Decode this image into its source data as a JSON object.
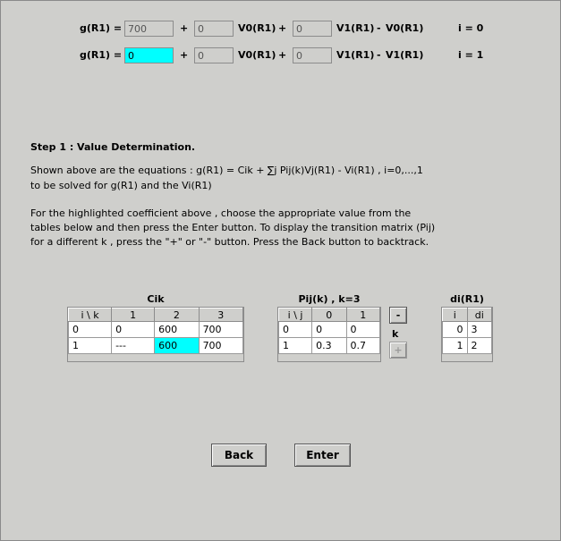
{
  "equations": [
    {
      "g_label": "g(R1) =",
      "g_value": "700",
      "plus1": "+",
      "coef_value": "0",
      "v_a_label": "V0(R1)",
      "plus2": "+",
      "coef2_value": "0",
      "v_b_label": "V1(R1)",
      "minus": "-",
      "v_c_label": "V0(R1)",
      "index": "i = 0"
    },
    {
      "g_label": "g(R1) =",
      "g_value": "0",
      "plus1": "+",
      "coef_value": "0",
      "v_a_label": "V0(R1)",
      "plus2": "+",
      "coef2_value": "0",
      "v_b_label": "V1(R1)",
      "minus": "-",
      "v_c_label": "V1(R1)",
      "index": "i = 1"
    }
  ],
  "step": {
    "title": "Step 1 :  Value Determination.",
    "line1": "Shown above are the equations : g(R1) = Cik + ∑j Pij(k)Vj(R1) - Vi(R1) , i=0,...,1",
    "line2": "to be solved for g(R1) and the Vi(R1)",
    "line3": "For the highlighted coefficient above , choose the appropriate value from the",
    "line4": "tables below and then press the Enter button. To display the transition matrix (Pij)",
    "line5": "for a different k , press the \"+\" or \"-\" button. Press the Back button to backtrack."
  },
  "cik": {
    "title": "Cik",
    "headers": [
      "i \\ k",
      "1",
      "2",
      "3"
    ],
    "rows": [
      [
        "0",
        "0",
        "600",
        "700"
      ],
      [
        "1",
        "---",
        "600",
        "700"
      ]
    ]
  },
  "pij": {
    "title": "Pij(k) , k=3",
    "headers": [
      "i \\ j",
      "0",
      "1"
    ],
    "rows": [
      [
        "0",
        "0",
        "0"
      ],
      [
        "1",
        "0.3",
        "0.7"
      ]
    ],
    "minus_label": "-",
    "k_label": "k",
    "plus_label": "+"
  },
  "di": {
    "title": "di(R1)",
    "headers": [
      "i",
      "di"
    ],
    "rows": [
      [
        "0",
        "3"
      ],
      [
        "1",
        "2"
      ]
    ]
  },
  "buttons": {
    "back": "Back",
    "enter": "Enter"
  },
  "colors": {
    "background": "#cfcfcc",
    "highlight": "#00ffff"
  }
}
